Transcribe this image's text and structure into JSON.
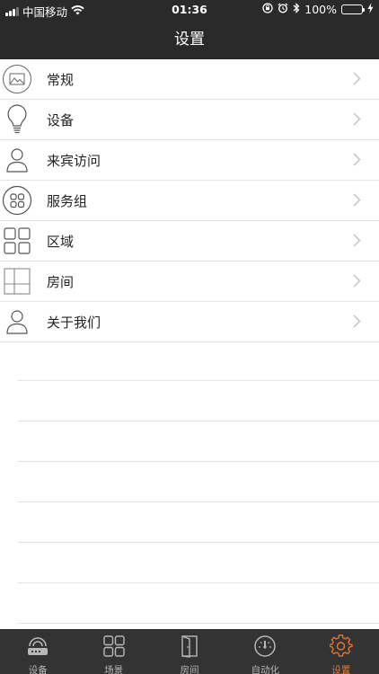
{
  "status_bar": {
    "carrier": "中国移动",
    "time": "01:36",
    "battery": "100%",
    "icons": [
      "signal-icon",
      "wifi-icon",
      "orientation-lock-icon",
      "alarm-icon",
      "bluetooth-icon",
      "battery-icon",
      "charging-icon"
    ]
  },
  "nav": {
    "title": "设置"
  },
  "settings": {
    "items": [
      {
        "label": "常规",
        "icon": "picture-icon"
      },
      {
        "label": "设备",
        "icon": "lightbulb-icon"
      },
      {
        "label": "来宾访问",
        "icon": "person-icon"
      },
      {
        "label": "服务组",
        "icon": "group-icon"
      },
      {
        "label": "区域",
        "icon": "grid-icon"
      },
      {
        "label": "房间",
        "icon": "room-layout-icon"
      },
      {
        "label": "关于我们",
        "icon": "person-icon"
      }
    ]
  },
  "tabbar": {
    "tabs": [
      {
        "label": "设备",
        "icon": "router-icon",
        "active": false
      },
      {
        "label": "场景",
        "icon": "grid-icon",
        "active": false
      },
      {
        "label": "房间",
        "icon": "door-icon",
        "active": false
      },
      {
        "label": "自动化",
        "icon": "gauge-icon",
        "active": false
      },
      {
        "label": "设置",
        "icon": "gear-icon",
        "active": true
      }
    ],
    "active_color": "#e8772e",
    "inactive_color": "#b8b8b8"
  }
}
